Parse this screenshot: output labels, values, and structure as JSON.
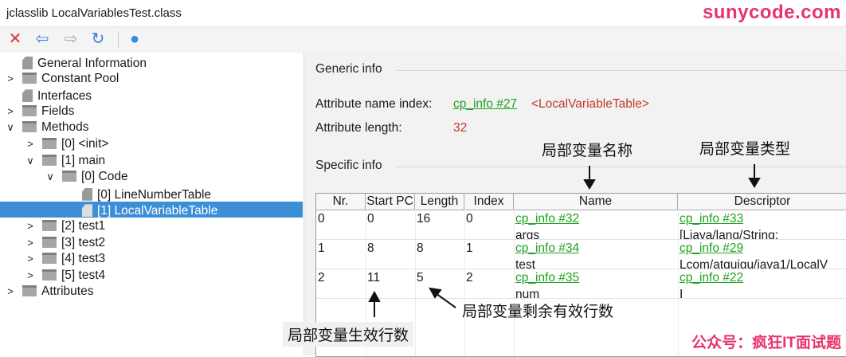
{
  "window": {
    "title": "jclasslib LocalVariablesTest.class",
    "watermark": "sunycode.com"
  },
  "toolbar": {
    "close": "✕",
    "back": "⇦",
    "forward": "⇨",
    "refresh": "↻",
    "web": "●"
  },
  "tree": [
    {
      "label": "General Information",
      "type": "leaf"
    },
    {
      "label": "Constant Pool",
      "type": "folder",
      "arrow": "›"
    },
    {
      "label": "Interfaces",
      "type": "leaf"
    },
    {
      "label": "Fields",
      "type": "folder",
      "arrow": "›"
    },
    {
      "label": "Methods",
      "type": "folder",
      "arrow": "⌄"
    },
    {
      "label": "[0] <init>",
      "type": "folder",
      "arrow": "›"
    },
    {
      "label": "[1] main",
      "type": "folder",
      "arrow": "⌄"
    },
    {
      "label": "[0] Code",
      "type": "folder",
      "arrow": "⌄"
    },
    {
      "label": "[0] LineNumberTable",
      "type": "leaf"
    },
    {
      "label": "[1] LocalVariableTable",
      "type": "leaf",
      "selected": true
    },
    {
      "label": "[2] test1",
      "type": "folder",
      "arrow": "›"
    },
    {
      "label": "[3] test2",
      "type": "folder",
      "arrow": "›"
    },
    {
      "label": "[4] test3",
      "type": "folder",
      "arrow": "›"
    },
    {
      "label": "[5] test4",
      "type": "folder",
      "arrow": "›"
    },
    {
      "label": "Attributes",
      "type": "folder",
      "arrow": "›"
    }
  ],
  "generic": {
    "header": "Generic info",
    "name_label": "Attribute name index:",
    "name_link": "cp_info #27",
    "name_value": "<LocalVariableTable>",
    "length_label": "Attribute length:",
    "length_value": "32"
  },
  "specific": {
    "header": "Specific info"
  },
  "table": {
    "columns": [
      "Nr.",
      "Start PC",
      "Length",
      "Index",
      "Name",
      "Descriptor"
    ],
    "rows": [
      {
        "nr": "0",
        "start": "0",
        "length": "16",
        "index": "0",
        "name_link": "cp_info #32",
        "name_val": "args",
        "desc_link": "cp_info #33",
        "desc_val": "[Ljava/lang/String;"
      },
      {
        "nr": "1",
        "start": "8",
        "length": "8",
        "index": "1",
        "name_link": "cp_info #34",
        "name_val": "test",
        "desc_link": "cp_info #29",
        "desc_val": "Lcom/atguigu/java1/LocalV"
      },
      {
        "nr": "2",
        "start": "11",
        "length": "5",
        "index": "2",
        "name_link": "cp_info #35",
        "name_val": "num",
        "desc_link": "cp_info #22",
        "desc_val": "I"
      }
    ]
  },
  "annotations": {
    "name": "局部变量名称",
    "type": "局部变量类型",
    "remaining": "局部变量剩余有效行数",
    "start": "局部变量生效行数",
    "footer": "公众号：疯狂IT面试题"
  }
}
